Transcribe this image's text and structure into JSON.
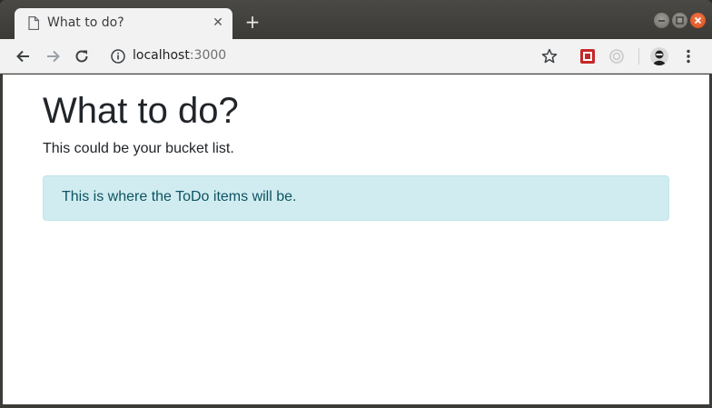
{
  "browser": {
    "tab": {
      "title": "What to do?",
      "close_glyph": "✕",
      "icon": "document-icon"
    },
    "new_tab_glyph": "+",
    "window_controls": [
      "minimize",
      "maximize",
      "close"
    ],
    "address": {
      "host": "localhost",
      "port": ":3000"
    },
    "colors": {
      "close_button": "#e05a26",
      "tab_strip": "#3c3b37",
      "toolbar": "#f2f2f2"
    }
  },
  "page": {
    "heading": "What to do?",
    "lead": "This could be your bucket list.",
    "alert": {
      "text": "This is where the ToDo items will be.",
      "bg": "#d1ecf1",
      "color": "#0c5460"
    }
  }
}
